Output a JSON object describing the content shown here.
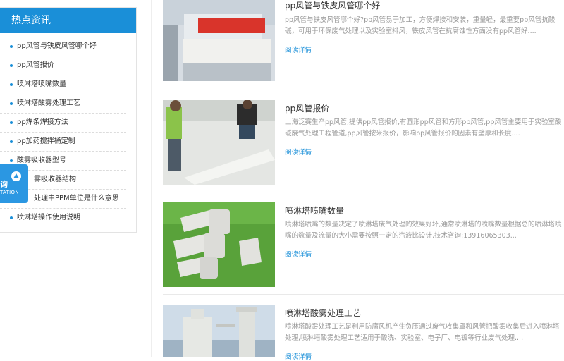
{
  "sidebar": {
    "title": "热点资讯",
    "items": [
      {
        "label": "pp风管与铁皮风管哪个好"
      },
      {
        "label": "pp风管报价"
      },
      {
        "label": "喷淋塔喷嘴数量"
      },
      {
        "label": "喷淋塔酸雾处理工艺"
      },
      {
        "label": "pp焊条焊接方法"
      },
      {
        "label": "pp加药搅拌桶定制"
      },
      {
        "label": "酸雾吸收器型号"
      },
      {
        "label": "雾吸收器结构"
      },
      {
        "label": "处理中PPM单位是什么意思"
      },
      {
        "label": "喷淋塔操作使用说明"
      }
    ]
  },
  "consult_widget": {
    "text": "询",
    "sub": "TATION"
  },
  "articles": [
    {
      "title": "pp风管与铁皮风管哪个好",
      "desc": "pp风管与铁皮风管哪个好?pp风管易于加工，方便焊接和安装，重量轻，最重要pp风管抗酸碱，可用于环保废气处理以及实验室排风，铁皮风管在抗腐蚀性方面没有pp风管好....",
      "more": "阅读详情",
      "thumb_icon": "workshop-photo-icon"
    },
    {
      "title": "pp风管报价",
      "desc": "上海泛赛生产pp风管,提供pp风管报价,有圆形pp风管和方形pp风管,pp风管主要用于实验室酸碱废气处理工程管道,pp风管按米报价，影响pp风管报价的因素有壁厚和长度....",
      "more": "阅读详情",
      "thumb_icon": "workers-photo-icon"
    },
    {
      "title": "喷淋塔喷嘴数量",
      "desc": "喷淋塔喷嘴的数量决定了喷淋塔废气处理的效果好坏,通常喷淋塔的喷嘴数量根据总的喷淋塔喷嘴的数量及流量的大小需要按照一定的汽液比设计,技术咨询:13916065303...",
      "more": "阅读详情",
      "thumb_icon": "nozzle-photo-icon"
    },
    {
      "title": "喷淋塔酸雾处理工艺",
      "desc": "喷淋塔酸雾处理工艺是利用防腐风机产生负压通过废气收集罩和风管把酸雾收集后进入喷淋塔处理,喷淋塔酸雾处理工艺适用于酸洗、实验室、电子厂、电镀等行业废气处理....",
      "more": "阅读详情",
      "thumb_icon": "tower-photo-icon"
    }
  ],
  "colors": {
    "accent": "#1a8fd8",
    "muted_text": "#999999"
  }
}
